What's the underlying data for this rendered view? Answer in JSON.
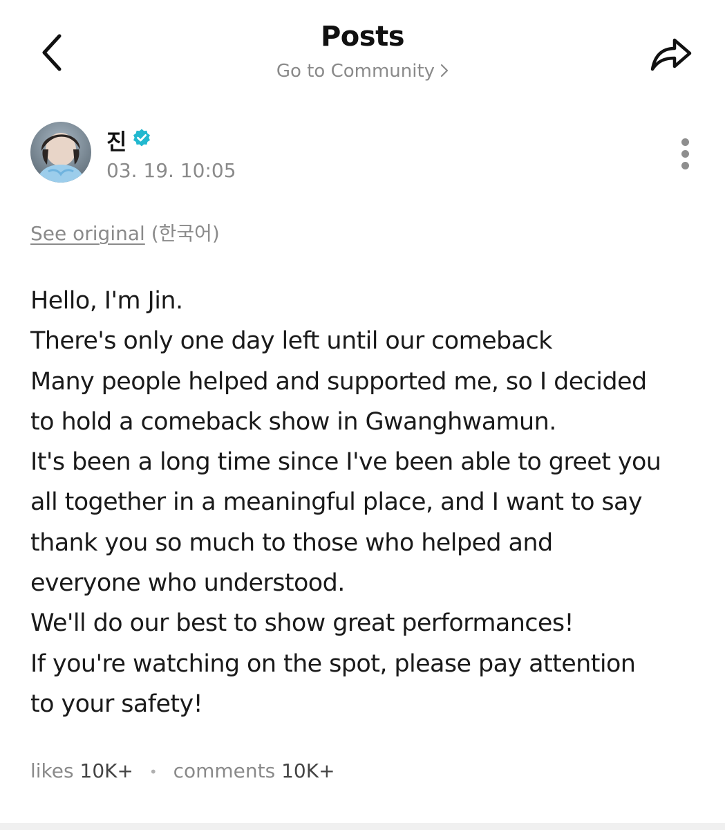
{
  "header": {
    "title": "Posts",
    "community_link": "Go to Community"
  },
  "post": {
    "author": "진",
    "date": "03. 19. 10:05",
    "see_original_label": "See original",
    "original_language": "(한국어)",
    "lines": [
      "Hello, I'm Jin.",
      "There's only one day left until our comeback",
      "Many people helped and supported me, so I decided",
      "to hold a comeback show in Gwanghwamun.",
      "It's been a long time since I've been able to greet you",
      "all together in a meaningful place, and I want to say",
      "thank you so much to those who helped and",
      "everyone who understood.",
      "We'll do our best to show great performances!",
      "If you're watching on the spot, please pay attention",
      "to your safety!"
    ]
  },
  "stats": {
    "likes_label": "likes",
    "likes_count": "10K+",
    "comments_label": "comments",
    "comments_count": "10K+",
    "separator": "•"
  },
  "icons": {
    "back": "chevron-left-icon",
    "share": "share-arrow-icon",
    "more": "more-vertical-icon",
    "verified": "verified-badge-icon"
  },
  "colors": {
    "verified_badge": "#22b8cf",
    "muted_text": "#8a8a8a",
    "body_text": "#1a1a1a"
  }
}
